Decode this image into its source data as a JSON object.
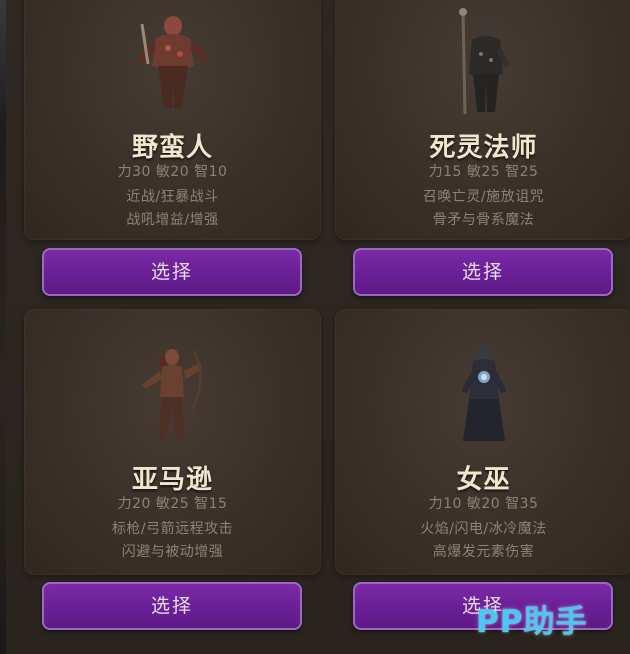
{
  "classes": [
    {
      "name": "野蛮人",
      "stats": "力30 敏20 智10",
      "line1": "近战/狂暴战斗",
      "line2": "战吼增益/增强",
      "button": "选择"
    },
    {
      "name": "死灵法师",
      "stats": "力15 敏25 智25",
      "line1": "召唤亡灵/施放诅咒",
      "line2": "骨矛与骨系魔法",
      "button": "选择"
    },
    {
      "name": "亚马逊",
      "stats": "力20 敏25 智15",
      "line1": "标枪/弓箭远程攻击",
      "line2": "闪避与被动增强",
      "button": "选择"
    },
    {
      "name": "女巫",
      "stats": "力10 敏20 智35",
      "line1": "火焰/闪电/冰冷魔法",
      "line2": "高爆发元素伤害",
      "button": "选择"
    }
  ],
  "watermark": "PP助手",
  "colors": {
    "button": "#6a1f96",
    "button_border": "#9b6ac0",
    "watermark": "#4ac8f4"
  },
  "icons": {
    "barbarian": "barbarian-portrait",
    "necromancer": "necromancer-portrait",
    "amazon": "amazon-portrait",
    "sorceress": "sorceress-portrait"
  }
}
